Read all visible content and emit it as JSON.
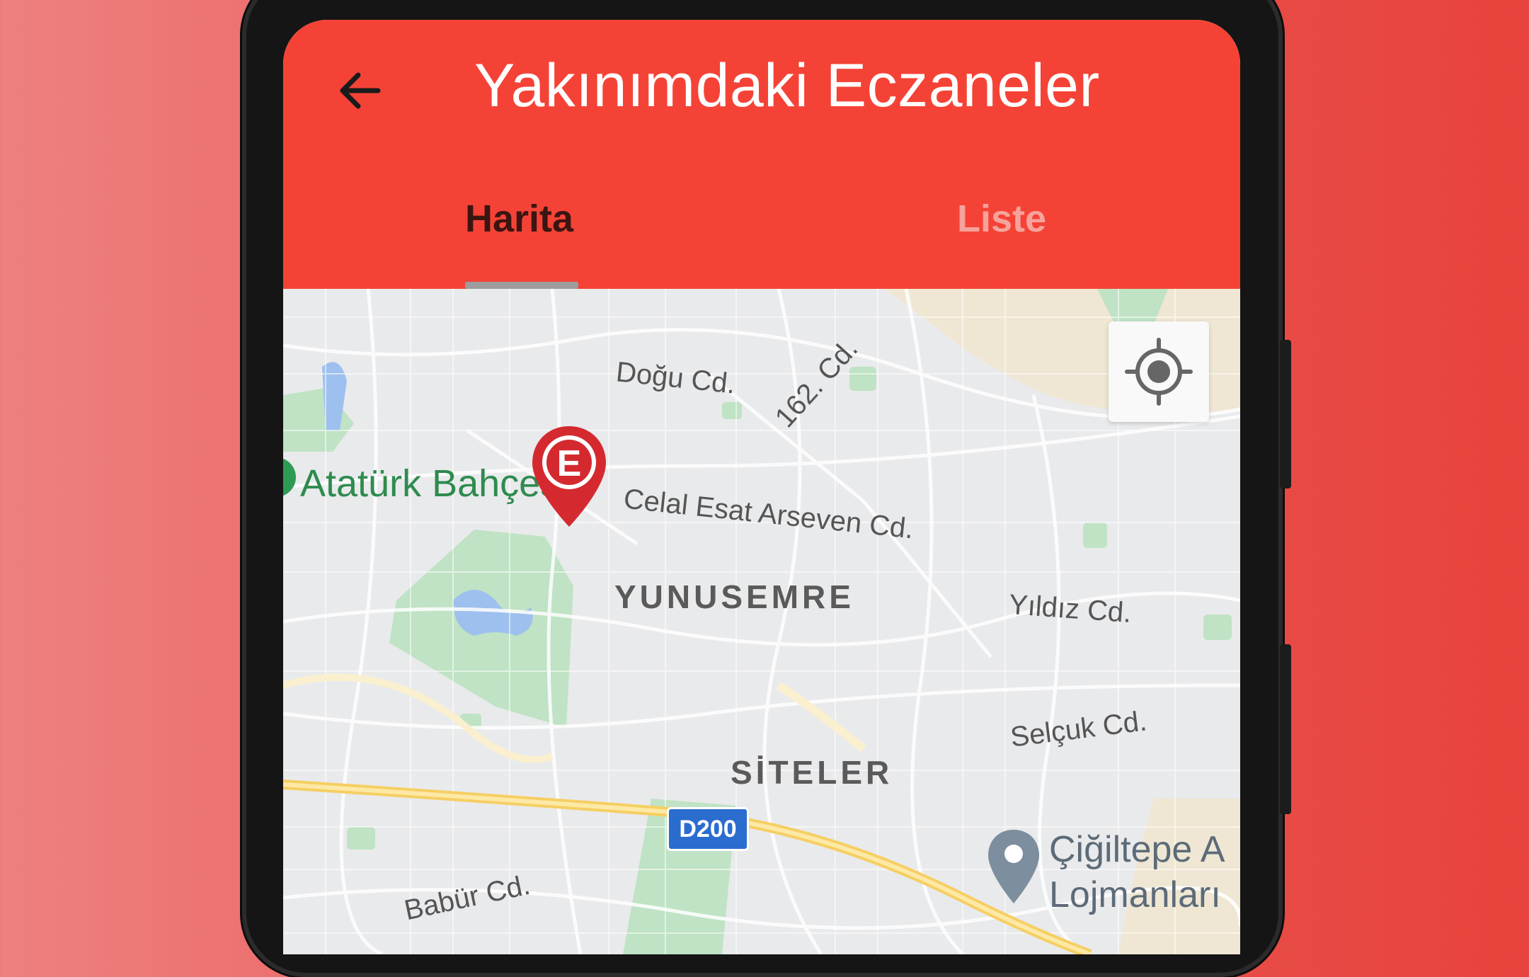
{
  "appbar": {
    "title": "Yakınımdaki Eczaneler",
    "tabs": [
      {
        "label": "Harita",
        "active": true
      },
      {
        "label": "Liste",
        "active": false
      }
    ]
  },
  "map": {
    "park_label": "Atatürk Bahçesi",
    "roads": [
      "Doğu Cd.",
      "162. Cd.",
      "Celal Esat Arseven Cd.",
      "Yıldız Cd.",
      "Selçuk Cd.",
      "Babür Cd."
    ],
    "districts": [
      "YUNUSEMRE",
      "SİTELER"
    ],
    "highway": "D200",
    "place": {
      "line1": "Çiğiltepe A",
      "line2": "Lojmanları"
    },
    "pharmacy_marker": "E"
  },
  "icons": {
    "back": "arrow-back-icon",
    "locate": "my-location-icon",
    "pharmacy": "pharmacy-pin-icon",
    "place": "place-pin-icon"
  },
  "colors": {
    "appbar": "#f44336",
    "tab_active": "#3b1512",
    "tab_inactive": "#f6a39c",
    "marker": "#d42a2f"
  }
}
